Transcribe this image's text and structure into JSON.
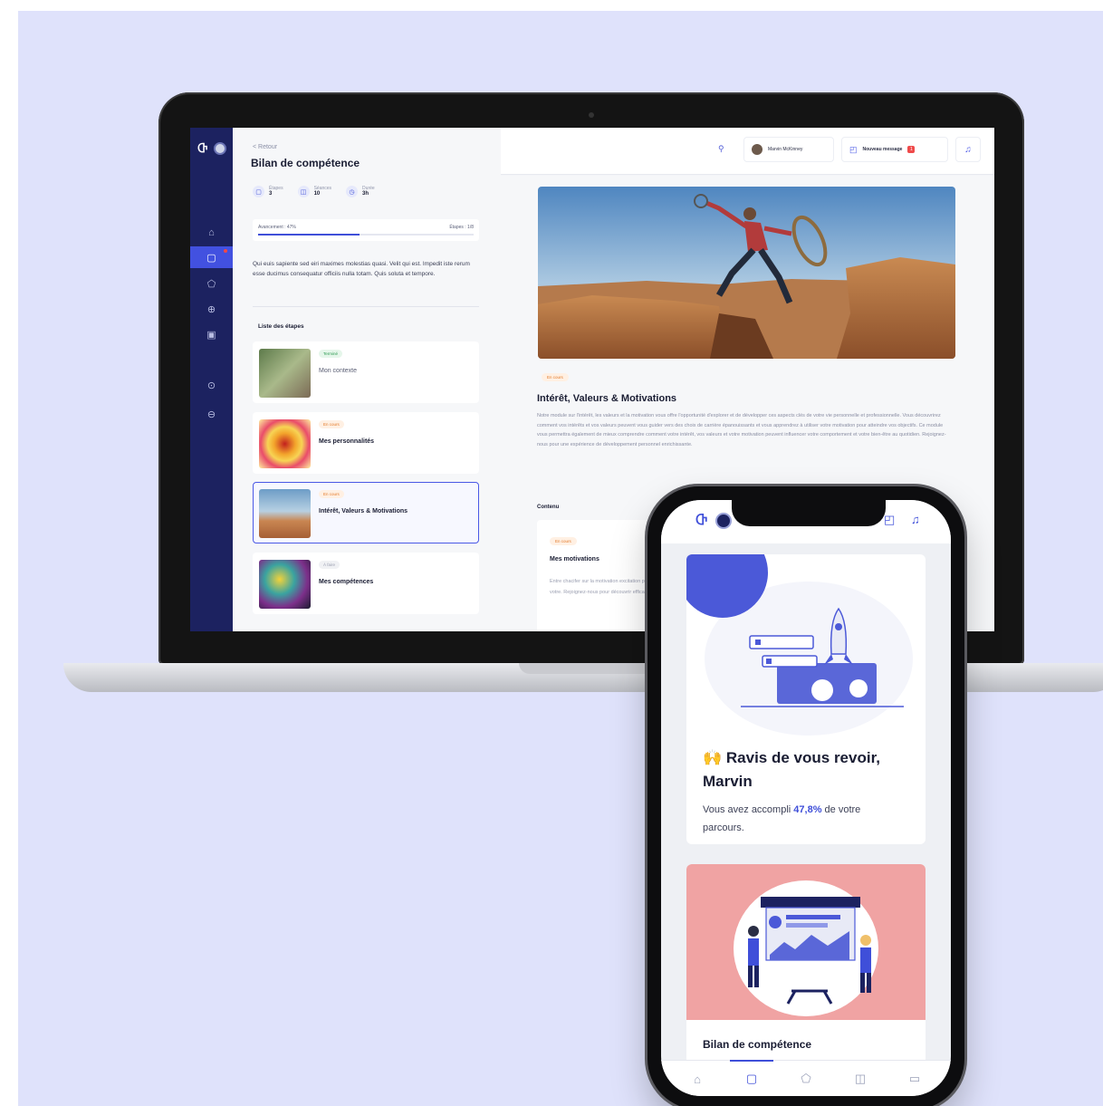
{
  "laptop": {
    "sidebar": {
      "logo": "Ⴇ",
      "items": [
        {
          "icon": "home-icon",
          "glyph": "⌂"
        },
        {
          "icon": "clipboard-icon",
          "glyph": "▢"
        },
        {
          "icon": "puzzle-icon",
          "glyph": "⬠"
        },
        {
          "icon": "briefcase-icon",
          "glyph": "⊕"
        },
        {
          "icon": "calendar-icon",
          "glyph": "▣"
        },
        {
          "icon": "help-icon",
          "glyph": "⊙"
        },
        {
          "icon": "settings-icon",
          "glyph": "⊖"
        }
      ]
    },
    "header": {
      "back": "< Retour",
      "title": "Bilan de compétence"
    },
    "stats": [
      {
        "label": "Étapes",
        "value": "3"
      },
      {
        "label": "Séances",
        "value": "10"
      },
      {
        "label": "Durée",
        "value": "3h"
      }
    ],
    "progress": {
      "left": "Avancement : 47%",
      "right": "Étapes : 1/8",
      "fraction": 0.47
    },
    "description": "Qui euis sapiente sed eiri maximes molestias quasi. Velit qui est. Impedit iste rerum esse ducimus consequatur officiis nulla totam. Quis soluta et tempore.",
    "steps_title": "Liste des étapes",
    "steps": [
      {
        "badge": "Terminé",
        "status": "done",
        "name": "Mon contexte"
      },
      {
        "badge": "En cours",
        "status": "prog",
        "name": "Mes personnalités"
      },
      {
        "badge": "En cours",
        "status": "prog",
        "name": "Intérêt, Valeurs & Motivations"
      },
      {
        "badge": "À faire",
        "status": "lock",
        "name": "Mes compétences"
      }
    ],
    "topbar": {
      "user": "Marvin McKinney",
      "message": "Nouveau message",
      "message_count": "1"
    },
    "module": {
      "badge": "En cours",
      "title": "Intérêt, Valeurs & Motivations",
      "description": "Notre module sur l'intérêt, les valeurs et la motivation vous offre l'opportunité d'explorer et de développer ces aspects clés de votre vie personnelle et professionnelle. Vous découvrirez comment vos intérêts et vos valeurs peuvent vous guider vers des choix de carrière épanouissants et vous apprendrez à utiliser votre motivation pour atteindre vos objectifs. Ce module vous permettra également de mieux comprendre comment votre intérêt, vos valeurs et votre motivation peuvent influencer votre comportement et votre bien-être au quotidien. Rejoignez-nous pour une expérience de développement personnel enrichissante.",
      "content_label": "Contenu",
      "content_card": {
        "badge": "En cours",
        "title": "Mes motivations",
        "description": "Entre chacifer sur la motivation excitation pour influencer votre. Rejoignez-nous pour découvrir efficace."
      }
    }
  },
  "phone": {
    "greeting": "🙌 Ravis de vous revoir, Marvin",
    "sub_prefix": "Vous avez accompli ",
    "sub_highlight": "47,8%",
    "sub_suffix": " de votre parcours.",
    "card2_title": "Bilan de compétence",
    "tabs": [
      {
        "icon": "home-icon",
        "glyph": "⌂"
      },
      {
        "icon": "clipboard-icon",
        "glyph": "▢"
      },
      {
        "icon": "puzzle-icon",
        "glyph": "⬠"
      },
      {
        "icon": "map-icon",
        "glyph": "◫"
      },
      {
        "icon": "calendar-icon",
        "glyph": "▭"
      }
    ]
  },
  "colors": {
    "accent": "#3f4fd9",
    "sidebar": "#1c2260",
    "background": "#dfe2fb"
  }
}
